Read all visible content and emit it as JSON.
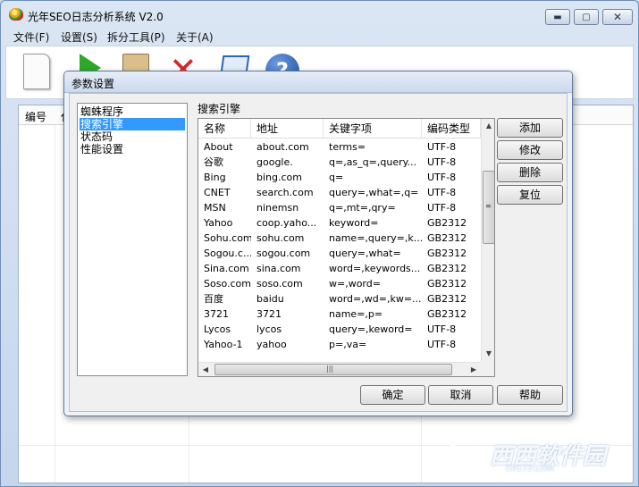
{
  "app": {
    "title": "光年SEO日志分析系统 V2.0",
    "window_buttons": {
      "minimize": "▬",
      "maximize": "▢",
      "close": "✕"
    }
  },
  "menu": {
    "items": [
      "文件(F)",
      "设置(S)",
      "拆分工具(P)",
      "关于(A)"
    ]
  },
  "toolbar": {
    "icons": [
      "new-document-icon",
      "run-play-icon",
      "clipboard-icon",
      "delete-x-icon",
      "edit-icon",
      "help-icon"
    ]
  },
  "list": {
    "columns": [
      "编号",
      "代"
    ]
  },
  "dialog": {
    "title": "参数设置",
    "tree_items": [
      "蜘蛛程序",
      "搜索引擎",
      "状态码",
      "性能设置"
    ],
    "selected_tree_item": "搜索引擎",
    "section_label": "搜索引擎",
    "table": {
      "columns": [
        "名称",
        "地址",
        "关键字项",
        "编码类型"
      ],
      "rows": [
        {
          "name": "About",
          "address": "about.com",
          "keyword": "terms=",
          "encoding": "UTF-8"
        },
        {
          "name": "谷歌",
          "address": "google.",
          "keyword": "q=,as_q=,query...",
          "encoding": "UTF-8"
        },
        {
          "name": "Bing",
          "address": "bing.com",
          "keyword": "q=",
          "encoding": "UTF-8"
        },
        {
          "name": "CNET",
          "address": "search.com",
          "keyword": "query=,what=,q=",
          "encoding": "UTF-8"
        },
        {
          "name": "MSN",
          "address": "ninemsn",
          "keyword": "q=,mt=,qry=",
          "encoding": "UTF-8"
        },
        {
          "name": "Yahoo",
          "address": "coop.yaho...",
          "keyword": "keyword=",
          "encoding": "GB2312"
        },
        {
          "name": "Sohu.com",
          "address": "sohu.com",
          "keyword": "name=,query=,k...",
          "encoding": "GB2312"
        },
        {
          "name": "Sogou.c...",
          "address": "sogou.com",
          "keyword": "query=,what=",
          "encoding": "GB2312"
        },
        {
          "name": "Sina.com",
          "address": "sina.com",
          "keyword": "word=,keywords...",
          "encoding": "GB2312"
        },
        {
          "name": "Soso.com",
          "address": "soso.com",
          "keyword": "w=,word=",
          "encoding": "GB2312"
        },
        {
          "name": "百度",
          "address": "baidu",
          "keyword": "word=,wd=,kw=...",
          "encoding": "GB2312"
        },
        {
          "name": "3721",
          "address": "3721",
          "keyword": "name=,p=",
          "encoding": "GB2312"
        },
        {
          "name": "Lycos",
          "address": "lycos",
          "keyword": "query=,keword=",
          "encoding": "UTF-8"
        },
        {
          "name": "Yahoo-1",
          "address": "yahoo",
          "keyword": "p=,va=",
          "encoding": "UTF-8"
        }
      ]
    },
    "side_buttons": [
      "添加",
      "修改",
      "删除",
      "复位"
    ],
    "footer_buttons": {
      "ok": "确定",
      "cancel": "取消",
      "help": "帮助"
    }
  },
  "watermark": {
    "text": "西西软件园",
    "sub": "CR173.COM"
  }
}
